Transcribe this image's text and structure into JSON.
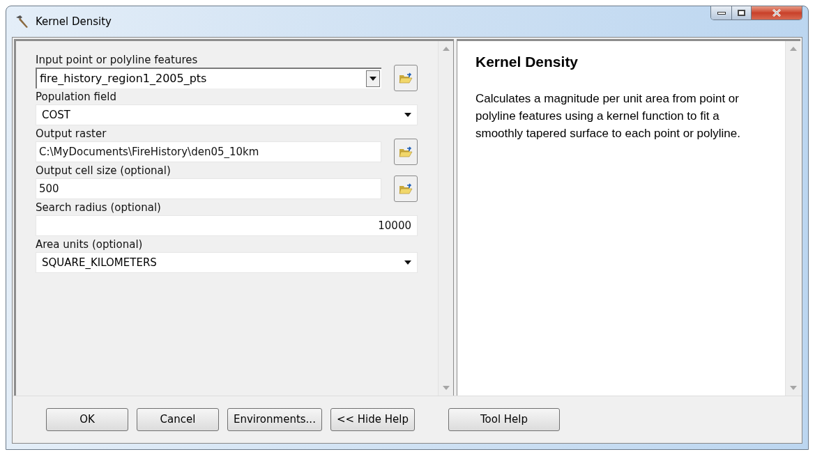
{
  "window": {
    "title": "Kernel Density"
  },
  "parameters": [
    {
      "label": "Input point or polyline features",
      "kind": "combo",
      "value": "fire_history_region1_2005_pts",
      "browse": true
    },
    {
      "label": "Population field",
      "kind": "dropdown",
      "value": "COST",
      "browse": false
    },
    {
      "label": "Output raster",
      "kind": "text",
      "value": "C:\\MyDocuments\\FireHistory\\den05_10km",
      "browse": true
    },
    {
      "label": "Output cell size (optional)",
      "kind": "text",
      "value": "500",
      "browse": true
    },
    {
      "label": "Search radius (optional)",
      "kind": "number",
      "value": "10000",
      "browse": false
    },
    {
      "label": "Area units (optional)",
      "kind": "dropdown",
      "value": "SQUARE_KILOMETERS",
      "browse": false
    }
  ],
  "help": {
    "title": "Kernel Density",
    "body": "Calculates a magnitude per unit area from point or polyline features using a kernel function to fit a smoothly tapered surface to each point or polyline."
  },
  "buttons": [
    {
      "label": "OK",
      "kind": "normal"
    },
    {
      "label": "Cancel",
      "kind": "normal"
    },
    {
      "label": "Environments...",
      "kind": "normal"
    },
    {
      "label": "<< Hide Help",
      "kind": "normal"
    },
    {
      "label": "Tool Help",
      "kind": "help"
    }
  ]
}
